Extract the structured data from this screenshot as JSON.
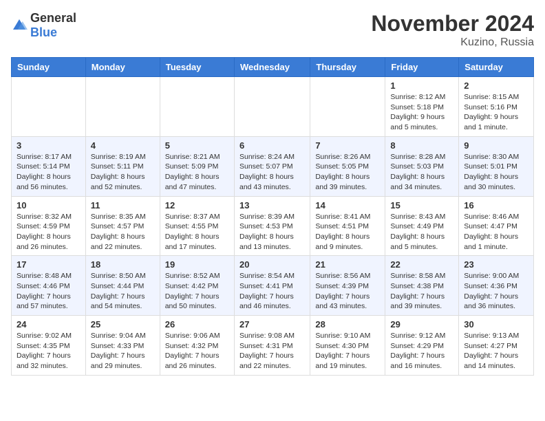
{
  "header": {
    "logo_general": "General",
    "logo_blue": "Blue",
    "month_title": "November 2024",
    "location": "Kuzino, Russia"
  },
  "columns": [
    "Sunday",
    "Monday",
    "Tuesday",
    "Wednesday",
    "Thursday",
    "Friday",
    "Saturday"
  ],
  "weeks": [
    [
      {
        "day": "",
        "info": ""
      },
      {
        "day": "",
        "info": ""
      },
      {
        "day": "",
        "info": ""
      },
      {
        "day": "",
        "info": ""
      },
      {
        "day": "",
        "info": ""
      },
      {
        "day": "1",
        "info": "Sunrise: 8:12 AM\nSunset: 5:18 PM\nDaylight: 9 hours\nand 5 minutes."
      },
      {
        "day": "2",
        "info": "Sunrise: 8:15 AM\nSunset: 5:16 PM\nDaylight: 9 hours\nand 1 minute."
      }
    ],
    [
      {
        "day": "3",
        "info": "Sunrise: 8:17 AM\nSunset: 5:14 PM\nDaylight: 8 hours\nand 56 minutes."
      },
      {
        "day": "4",
        "info": "Sunrise: 8:19 AM\nSunset: 5:11 PM\nDaylight: 8 hours\nand 52 minutes."
      },
      {
        "day": "5",
        "info": "Sunrise: 8:21 AM\nSunset: 5:09 PM\nDaylight: 8 hours\nand 47 minutes."
      },
      {
        "day": "6",
        "info": "Sunrise: 8:24 AM\nSunset: 5:07 PM\nDaylight: 8 hours\nand 43 minutes."
      },
      {
        "day": "7",
        "info": "Sunrise: 8:26 AM\nSunset: 5:05 PM\nDaylight: 8 hours\nand 39 minutes."
      },
      {
        "day": "8",
        "info": "Sunrise: 8:28 AM\nSunset: 5:03 PM\nDaylight: 8 hours\nand 34 minutes."
      },
      {
        "day": "9",
        "info": "Sunrise: 8:30 AM\nSunset: 5:01 PM\nDaylight: 8 hours\nand 30 minutes."
      }
    ],
    [
      {
        "day": "10",
        "info": "Sunrise: 8:32 AM\nSunset: 4:59 PM\nDaylight: 8 hours\nand 26 minutes."
      },
      {
        "day": "11",
        "info": "Sunrise: 8:35 AM\nSunset: 4:57 PM\nDaylight: 8 hours\nand 22 minutes."
      },
      {
        "day": "12",
        "info": "Sunrise: 8:37 AM\nSunset: 4:55 PM\nDaylight: 8 hours\nand 17 minutes."
      },
      {
        "day": "13",
        "info": "Sunrise: 8:39 AM\nSunset: 4:53 PM\nDaylight: 8 hours\nand 13 minutes."
      },
      {
        "day": "14",
        "info": "Sunrise: 8:41 AM\nSunset: 4:51 PM\nDaylight: 8 hours\nand 9 minutes."
      },
      {
        "day": "15",
        "info": "Sunrise: 8:43 AM\nSunset: 4:49 PM\nDaylight: 8 hours\nand 5 minutes."
      },
      {
        "day": "16",
        "info": "Sunrise: 8:46 AM\nSunset: 4:47 PM\nDaylight: 8 hours\nand 1 minute."
      }
    ],
    [
      {
        "day": "17",
        "info": "Sunrise: 8:48 AM\nSunset: 4:46 PM\nDaylight: 7 hours\nand 57 minutes."
      },
      {
        "day": "18",
        "info": "Sunrise: 8:50 AM\nSunset: 4:44 PM\nDaylight: 7 hours\nand 54 minutes."
      },
      {
        "day": "19",
        "info": "Sunrise: 8:52 AM\nSunset: 4:42 PM\nDaylight: 7 hours\nand 50 minutes."
      },
      {
        "day": "20",
        "info": "Sunrise: 8:54 AM\nSunset: 4:41 PM\nDaylight: 7 hours\nand 46 minutes."
      },
      {
        "day": "21",
        "info": "Sunrise: 8:56 AM\nSunset: 4:39 PM\nDaylight: 7 hours\nand 43 minutes."
      },
      {
        "day": "22",
        "info": "Sunrise: 8:58 AM\nSunset: 4:38 PM\nDaylight: 7 hours\nand 39 minutes."
      },
      {
        "day": "23",
        "info": "Sunrise: 9:00 AM\nSunset: 4:36 PM\nDaylight: 7 hours\nand 36 minutes."
      }
    ],
    [
      {
        "day": "24",
        "info": "Sunrise: 9:02 AM\nSunset: 4:35 PM\nDaylight: 7 hours\nand 32 minutes."
      },
      {
        "day": "25",
        "info": "Sunrise: 9:04 AM\nSunset: 4:33 PM\nDaylight: 7 hours\nand 29 minutes."
      },
      {
        "day": "26",
        "info": "Sunrise: 9:06 AM\nSunset: 4:32 PM\nDaylight: 7 hours\nand 26 minutes."
      },
      {
        "day": "27",
        "info": "Sunrise: 9:08 AM\nSunset: 4:31 PM\nDaylight: 7 hours\nand 22 minutes."
      },
      {
        "day": "28",
        "info": "Sunrise: 9:10 AM\nSunset: 4:30 PM\nDaylight: 7 hours\nand 19 minutes."
      },
      {
        "day": "29",
        "info": "Sunrise: 9:12 AM\nSunset: 4:29 PM\nDaylight: 7 hours\nand 16 minutes."
      },
      {
        "day": "30",
        "info": "Sunrise: 9:13 AM\nSunset: 4:27 PM\nDaylight: 7 hours\nand 14 minutes."
      }
    ]
  ]
}
